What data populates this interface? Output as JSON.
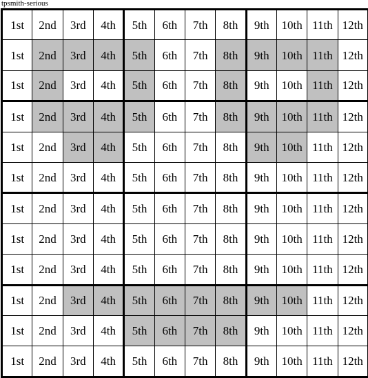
{
  "caption": "tpsmith-serious",
  "colors": {
    "shaded_cell": "#c0c0c0",
    "empty_cell": "#ffffff",
    "border": "#000000",
    "text": "#000000"
  },
  "grid": {
    "rows": 12,
    "columns": 12,
    "column_labels": [
      "1st",
      "2nd",
      "3rd",
      "4th",
      "5th",
      "6th",
      "7th",
      "8th",
      "9th",
      "10th",
      "11th",
      "12th"
    ],
    "thick_column_dividers_after": [
      4,
      8
    ],
    "thick_row_dividers_after": [
      3,
      6,
      9
    ],
    "cells": [
      [
        {
          "label": "1st",
          "shaded": false
        },
        {
          "label": "2nd",
          "shaded": false
        },
        {
          "label": "3rd",
          "shaded": false
        },
        {
          "label": "4th",
          "shaded": false
        },
        {
          "label": "5th",
          "shaded": false
        },
        {
          "label": "6th",
          "shaded": false
        },
        {
          "label": "7th",
          "shaded": false
        },
        {
          "label": "8th",
          "shaded": false
        },
        {
          "label": "9th",
          "shaded": false
        },
        {
          "label": "10th",
          "shaded": false
        },
        {
          "label": "11th",
          "shaded": false
        },
        {
          "label": "12th",
          "shaded": false
        }
      ],
      [
        {
          "label": "1st",
          "shaded": false
        },
        {
          "label": "2nd",
          "shaded": true
        },
        {
          "label": "3rd",
          "shaded": true
        },
        {
          "label": "4th",
          "shaded": true
        },
        {
          "label": "5th",
          "shaded": true
        },
        {
          "label": "6th",
          "shaded": false
        },
        {
          "label": "7th",
          "shaded": false
        },
        {
          "label": "8th",
          "shaded": true
        },
        {
          "label": "9th",
          "shaded": true
        },
        {
          "label": "10th",
          "shaded": true
        },
        {
          "label": "11th",
          "shaded": true
        },
        {
          "label": "12th",
          "shaded": false
        }
      ],
      [
        {
          "label": "1st",
          "shaded": false
        },
        {
          "label": "2nd",
          "shaded": true
        },
        {
          "label": "3rd",
          "shaded": false
        },
        {
          "label": "4th",
          "shaded": false
        },
        {
          "label": "5th",
          "shaded": true
        },
        {
          "label": "6th",
          "shaded": false
        },
        {
          "label": "7th",
          "shaded": false
        },
        {
          "label": "8th",
          "shaded": true
        },
        {
          "label": "9th",
          "shaded": false
        },
        {
          "label": "10th",
          "shaded": false
        },
        {
          "label": "11th",
          "shaded": true
        },
        {
          "label": "12th",
          "shaded": false
        }
      ],
      [
        {
          "label": "1st",
          "shaded": false
        },
        {
          "label": "2nd",
          "shaded": true
        },
        {
          "label": "3rd",
          "shaded": true
        },
        {
          "label": "4th",
          "shaded": true
        },
        {
          "label": "5th",
          "shaded": true
        },
        {
          "label": "6th",
          "shaded": false
        },
        {
          "label": "7th",
          "shaded": false
        },
        {
          "label": "8th",
          "shaded": true
        },
        {
          "label": "9th",
          "shaded": true
        },
        {
          "label": "10th",
          "shaded": true
        },
        {
          "label": "11th",
          "shaded": true
        },
        {
          "label": "12th",
          "shaded": false
        }
      ],
      [
        {
          "label": "1st",
          "shaded": false
        },
        {
          "label": "2nd",
          "shaded": false
        },
        {
          "label": "3rd",
          "shaded": true
        },
        {
          "label": "4th",
          "shaded": true
        },
        {
          "label": "5th",
          "shaded": false
        },
        {
          "label": "6th",
          "shaded": false
        },
        {
          "label": "7th",
          "shaded": false
        },
        {
          "label": "8th",
          "shaded": false
        },
        {
          "label": "9th",
          "shaded": true
        },
        {
          "label": "10th",
          "shaded": true
        },
        {
          "label": "11th",
          "shaded": false
        },
        {
          "label": "12th",
          "shaded": false
        }
      ],
      [
        {
          "label": "1st",
          "shaded": false
        },
        {
          "label": "2nd",
          "shaded": false
        },
        {
          "label": "3rd",
          "shaded": false
        },
        {
          "label": "4th",
          "shaded": false
        },
        {
          "label": "5th",
          "shaded": false
        },
        {
          "label": "6th",
          "shaded": false
        },
        {
          "label": "7th",
          "shaded": false
        },
        {
          "label": "8th",
          "shaded": false
        },
        {
          "label": "9th",
          "shaded": false
        },
        {
          "label": "10th",
          "shaded": false
        },
        {
          "label": "11th",
          "shaded": false
        },
        {
          "label": "12th",
          "shaded": false
        }
      ],
      [
        {
          "label": "1st",
          "shaded": false
        },
        {
          "label": "2nd",
          "shaded": false
        },
        {
          "label": "3rd",
          "shaded": false
        },
        {
          "label": "4th",
          "shaded": false
        },
        {
          "label": "5th",
          "shaded": false
        },
        {
          "label": "6th",
          "shaded": false
        },
        {
          "label": "7th",
          "shaded": false
        },
        {
          "label": "8th",
          "shaded": false
        },
        {
          "label": "9th",
          "shaded": false
        },
        {
          "label": "10th",
          "shaded": false
        },
        {
          "label": "11th",
          "shaded": false
        },
        {
          "label": "12th",
          "shaded": false
        }
      ],
      [
        {
          "label": "1st",
          "shaded": false
        },
        {
          "label": "2nd",
          "shaded": false
        },
        {
          "label": "3rd",
          "shaded": false
        },
        {
          "label": "4th",
          "shaded": false
        },
        {
          "label": "5th",
          "shaded": false
        },
        {
          "label": "6th",
          "shaded": false
        },
        {
          "label": "7th",
          "shaded": false
        },
        {
          "label": "8th",
          "shaded": false
        },
        {
          "label": "9th",
          "shaded": false
        },
        {
          "label": "10th",
          "shaded": false
        },
        {
          "label": "11th",
          "shaded": false
        },
        {
          "label": "12th",
          "shaded": false
        }
      ],
      [
        {
          "label": "1st",
          "shaded": false
        },
        {
          "label": "2nd",
          "shaded": false
        },
        {
          "label": "3rd",
          "shaded": false
        },
        {
          "label": "4th",
          "shaded": false
        },
        {
          "label": "5th",
          "shaded": false
        },
        {
          "label": "6th",
          "shaded": false
        },
        {
          "label": "7th",
          "shaded": false
        },
        {
          "label": "8th",
          "shaded": false
        },
        {
          "label": "9th",
          "shaded": false
        },
        {
          "label": "10th",
          "shaded": false
        },
        {
          "label": "11th",
          "shaded": false
        },
        {
          "label": "12th",
          "shaded": false
        }
      ],
      [
        {
          "label": "1st",
          "shaded": false
        },
        {
          "label": "2nd",
          "shaded": false
        },
        {
          "label": "3rd",
          "shaded": true
        },
        {
          "label": "4th",
          "shaded": true
        },
        {
          "label": "5th",
          "shaded": true
        },
        {
          "label": "6th",
          "shaded": true
        },
        {
          "label": "7th",
          "shaded": true
        },
        {
          "label": "8th",
          "shaded": true
        },
        {
          "label": "9th",
          "shaded": true
        },
        {
          "label": "10th",
          "shaded": true
        },
        {
          "label": "11th",
          "shaded": false
        },
        {
          "label": "12th",
          "shaded": false
        }
      ],
      [
        {
          "label": "1st",
          "shaded": false
        },
        {
          "label": "2nd",
          "shaded": false
        },
        {
          "label": "3rd",
          "shaded": false
        },
        {
          "label": "4th",
          "shaded": false
        },
        {
          "label": "5th",
          "shaded": true
        },
        {
          "label": "6th",
          "shaded": true
        },
        {
          "label": "7th",
          "shaded": true
        },
        {
          "label": "8th",
          "shaded": true
        },
        {
          "label": "9th",
          "shaded": false
        },
        {
          "label": "10th",
          "shaded": false
        },
        {
          "label": "11th",
          "shaded": false
        },
        {
          "label": "12th",
          "shaded": false
        }
      ],
      [
        {
          "label": "1st",
          "shaded": false
        },
        {
          "label": "2nd",
          "shaded": false
        },
        {
          "label": "3rd",
          "shaded": false
        },
        {
          "label": "4th",
          "shaded": false
        },
        {
          "label": "5th",
          "shaded": false
        },
        {
          "label": "6th",
          "shaded": false
        },
        {
          "label": "7th",
          "shaded": false
        },
        {
          "label": "8th",
          "shaded": false
        },
        {
          "label": "9th",
          "shaded": false
        },
        {
          "label": "10th",
          "shaded": false
        },
        {
          "label": "11th",
          "shaded": false
        },
        {
          "label": "12th",
          "shaded": false
        }
      ]
    ]
  }
}
